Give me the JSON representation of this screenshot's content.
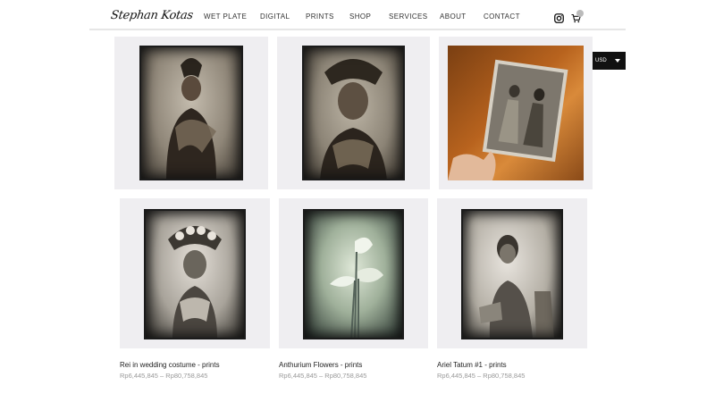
{
  "header": {
    "logo_text": "Stephan Kotas",
    "nav": [
      "WET PLATE",
      "DIGITAL",
      "PRINTS",
      "SHOP",
      "SERVICES",
      "ABOUT",
      "CONTACT"
    ],
    "icons": [
      "instagram-icon",
      "cart-icon"
    ]
  },
  "currency": {
    "selected": "USD"
  },
  "products_row2": [
    {
      "title": "Rei in wedding costume - prints",
      "price": "Rp6,445,845 – Rp80,758,845"
    },
    {
      "title": "Anthurium Flowers - prints",
      "price": "Rp6,445,845 – Rp80,758,845"
    },
    {
      "title": "Ariel Tatum #1 - prints",
      "price": "Rp6,445,845 – Rp80,758,845"
    }
  ]
}
